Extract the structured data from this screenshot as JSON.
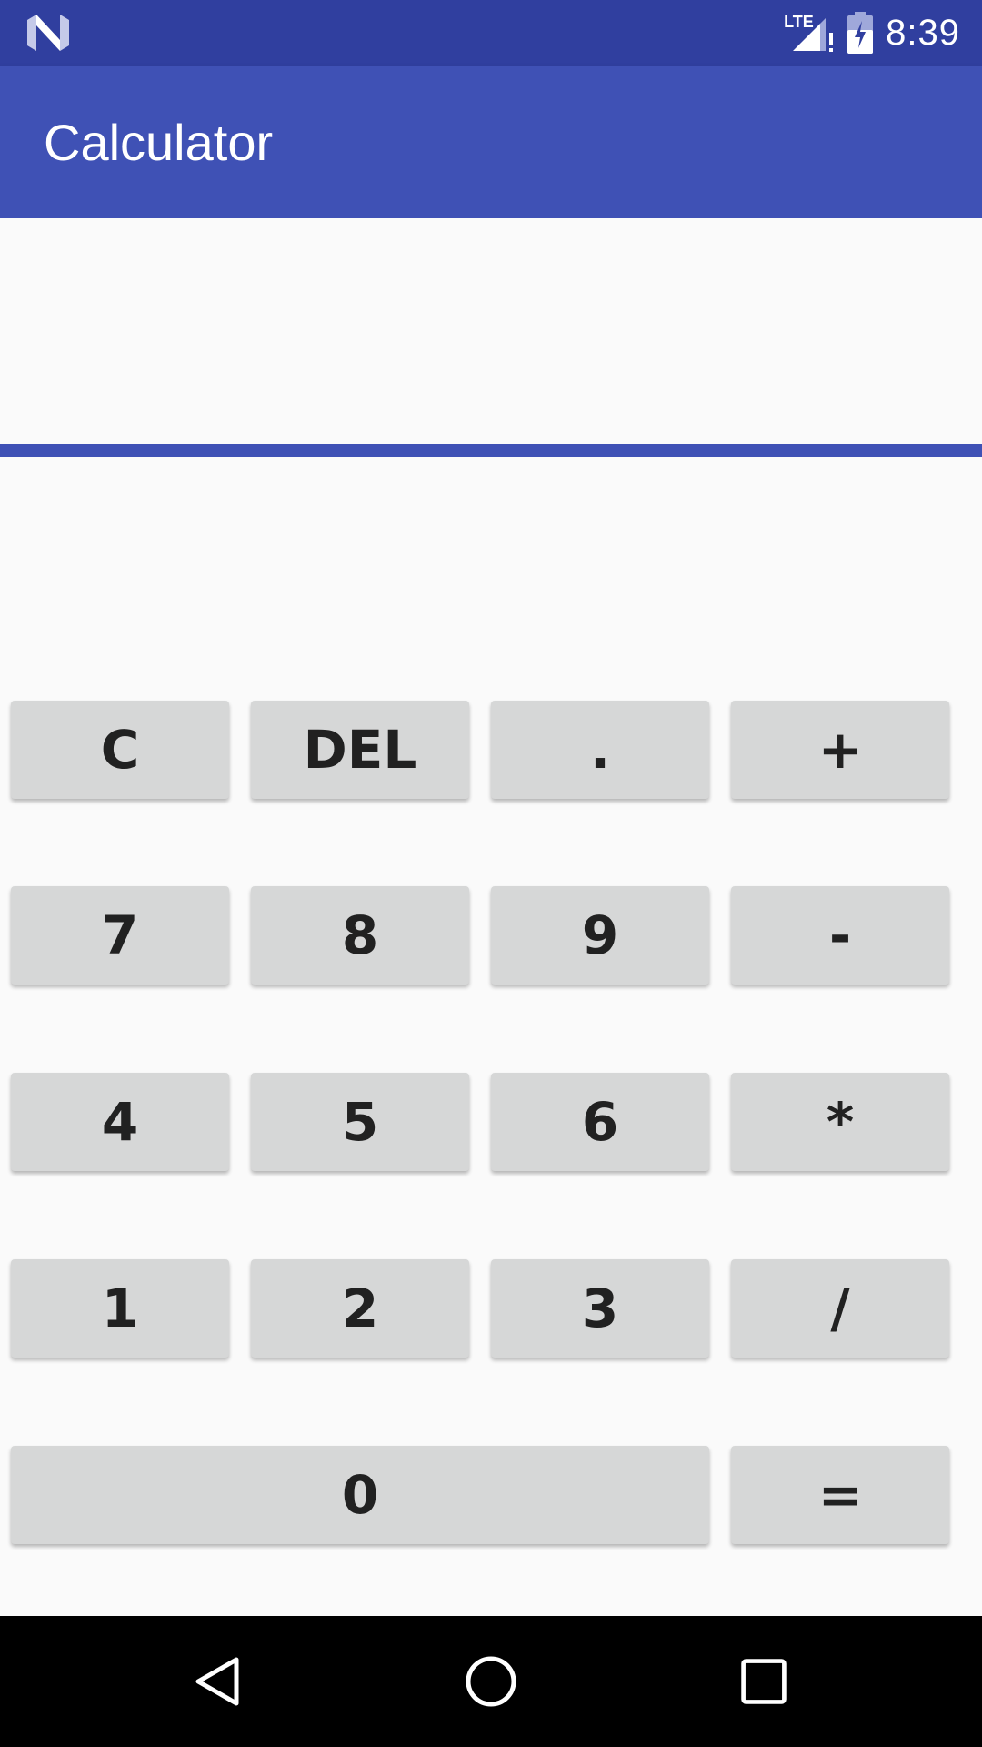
{
  "status_bar": {
    "left_icon": "n-logo-icon",
    "network_label": "LTE",
    "signal_icon": "signal-alert-icon",
    "battery_icon": "battery-charging-icon",
    "time": "8:39"
  },
  "app_bar": {
    "title": "Calculator"
  },
  "display": {
    "value": ""
  },
  "keypad": {
    "rows": [
      [
        "C",
        "DEL",
        ".",
        "+"
      ],
      [
        "7",
        "8",
        "9",
        "-"
      ],
      [
        "4",
        "5",
        "6",
        "*"
      ],
      [
        "1",
        "2",
        "3",
        "/"
      ],
      [
        "0",
        "="
      ]
    ]
  },
  "nav_bar": {
    "back_icon": "back-triangle-icon",
    "home_icon": "home-circle-icon",
    "recents_icon": "recents-square-icon"
  },
  "colors": {
    "status_bar": "#303f9f",
    "primary": "#3f51b5",
    "background": "#fafafa",
    "key_background": "#d6d7d7",
    "key_text": "#212121"
  }
}
